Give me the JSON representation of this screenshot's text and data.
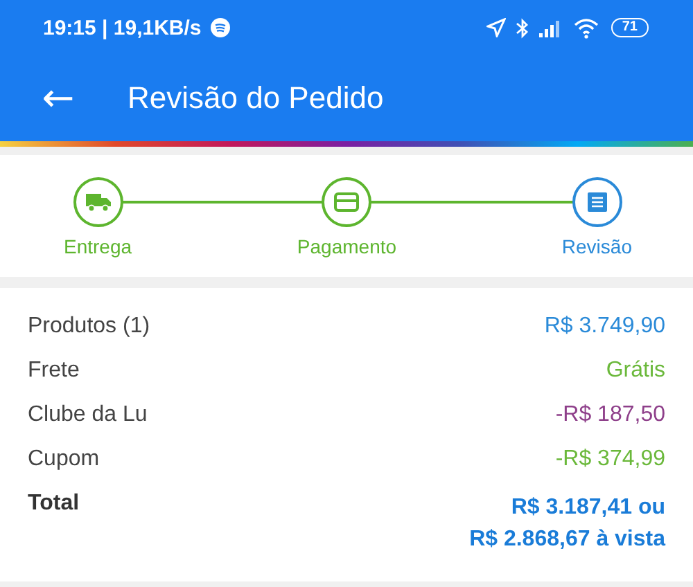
{
  "status_bar": {
    "time": "19:15 | 19,1KB/s",
    "battery": "71"
  },
  "app_bar": {
    "back": "←",
    "title": "Revisão do Pedido"
  },
  "steps": [
    {
      "label": "Entrega",
      "kind": "truck",
      "selected": false
    },
    {
      "label": "Pagamento",
      "kind": "card",
      "selected": false
    },
    {
      "label": "Revisão",
      "kind": "list",
      "selected": true
    }
  ],
  "summary": [
    {
      "label": "Produtos (1)",
      "value": "R$ 3.749,90",
      "color": "#2a8ad8"
    },
    {
      "label": "Frete",
      "value": "Grátis",
      "color": "#6ab83a"
    },
    {
      "label": "Clube da Lu",
      "value": "-R$ 187,50",
      "color": "#8e3f8a"
    },
    {
      "label": "Cupom",
      "value": "-R$ 374,99",
      "color": "#6ab83a"
    }
  ],
  "total": {
    "label": "Total",
    "lines": [
      "R$ 3.187,41 ou",
      "R$ 2.868,67 à vista"
    ]
  }
}
